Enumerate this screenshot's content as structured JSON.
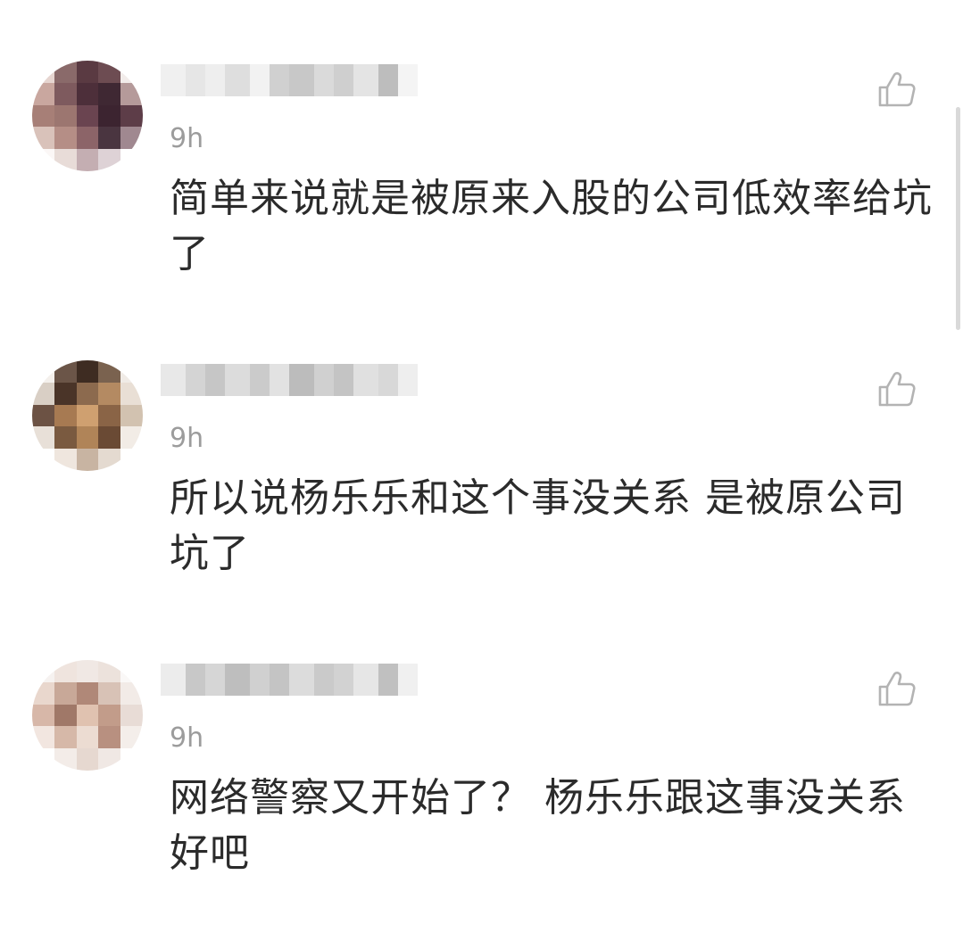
{
  "comments": [
    {
      "time": "9h",
      "text": "简单来说就是被原来入股的公司低效率给坑了",
      "like_icon": "thumbs-up-icon",
      "avatar_mosaic": [
        "#e6d5d0",
        "#8a6a6a",
        "#5a3a42",
        "#6d4c52",
        "#f2ecea",
        "#c9a79f",
        "#7e5a5e",
        "#4d2f3a",
        "#3f2833",
        "#b59a9a",
        "#a77f77",
        "#9c7670",
        "#6a4450",
        "#3c2430",
        "#5d3d48",
        "#d9c2ba",
        "#b58e86",
        "#8c6468",
        "#4a3540",
        "#a08890",
        "#fbf7f6",
        "#e8dcd8",
        "#c4aeb2",
        "#ded2d6",
        "#ffffff"
      ],
      "name_mosaic": [
        "#f0f0f0",
        "#e6e6e6",
        "#eeeeee",
        "#dedede",
        "#f2f2f2",
        "#d0d0d0",
        "#c8c8c8",
        "#dadada",
        "#cfcfcf",
        "#e4e4e4",
        "#bdbdbd",
        "#f4f4f4"
      ]
    },
    {
      "time": "9h",
      "text": "所以说杨乐乐和这个事没关系 是被原公司坑了",
      "like_icon": "thumbs-up-icon",
      "avatar_mosaic": [
        "#f4f0ec",
        "#6b5548",
        "#3e2c22",
        "#7a624f",
        "#f0ebe6",
        "#d9cfc5",
        "#4a3428",
        "#8c6a4e",
        "#b48a62",
        "#e9dfd5",
        "#6c5244",
        "#a77a52",
        "#cfa070",
        "#8a6446",
        "#d2c2b0",
        "#e8e0d8",
        "#7a5a40",
        "#b08458",
        "#6a4a34",
        "#f2ece6",
        "#ffffff",
        "#efe6de",
        "#c8b4a2",
        "#e4dad0",
        "#ffffff"
      ],
      "name_mosaic": [
        "#e8e8e8",
        "#d4d4d4",
        "#c6c6c6",
        "#dcdcdc",
        "#cbcbcb",
        "#e2e2e2",
        "#bcbcbc",
        "#d0d0d0",
        "#c4c4c4",
        "#e0e0e0",
        "#d8d8d8",
        "#eeeeee"
      ]
    },
    {
      "time": "9h",
      "text": "网络警察又开始了？ 杨乐乐跟这事没关系好吧",
      "like_icon": "thumbs-up-icon",
      "avatar_mosaic": [
        "#f6f2f0",
        "#efe4de",
        "#f0e8e4",
        "#ece2dc",
        "#faf8f7",
        "#e9d7cd",
        "#c8a898",
        "#b08878",
        "#d8c2b6",
        "#f2ebe7",
        "#d7b7a8",
        "#a07868",
        "#e0c2b0",
        "#c29c8a",
        "#e8dcd6",
        "#f2e6e0",
        "#d6b8a8",
        "#ecdcd2",
        "#b89080",
        "#f4eeea",
        "#ffffff",
        "#f3ece8",
        "#e6d8d0",
        "#f0e8e4",
        "#ffffff"
      ],
      "name_mosaic": [
        "#ececec",
        "#c8c8c8",
        "#d6d6d6",
        "#bebebe",
        "#d0d0d0",
        "#c4c4c4",
        "#dcdcdc",
        "#cacaca",
        "#d2d2d2",
        "#e6e6e6",
        "#c0c0c0",
        "#f0f0f0"
      ]
    }
  ]
}
